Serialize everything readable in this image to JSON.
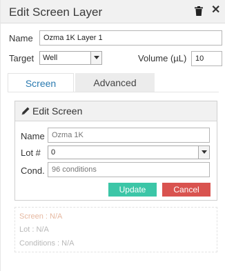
{
  "header": {
    "title": "Edit Screen Layer",
    "trash_icon": "trash-icon",
    "close_label": "✕"
  },
  "form": {
    "name_label": "Name",
    "name_value": "Ozma 1K Layer 1",
    "target_label": "Target",
    "target_value": "Well",
    "volume_label": "Volume (µL)",
    "volume_value": "10"
  },
  "tabs": [
    {
      "label": "Screen",
      "active": true
    },
    {
      "label": "Advanced",
      "active": false
    }
  ],
  "edit_screen": {
    "title": "Edit Screen",
    "icon": "pencil-icon",
    "name_label": "Name",
    "name_placeholder": "Ozma 1K",
    "lot_label": "Lot #",
    "lot_value": "0",
    "cond_label": "Cond.",
    "cond_placeholder": "96 conditions",
    "update_label": "Update",
    "cancel_label": "Cancel"
  },
  "info": {
    "screen": "Screen : N/A",
    "lot": "Lot : N/A",
    "conditions": "Conditions : N/A"
  },
  "colors": {
    "accent_tab": "#2a7ab0",
    "update_button": "#3cc6a7",
    "cancel_button": "#d9534f",
    "screen_info_text": "#e6b8a0"
  }
}
